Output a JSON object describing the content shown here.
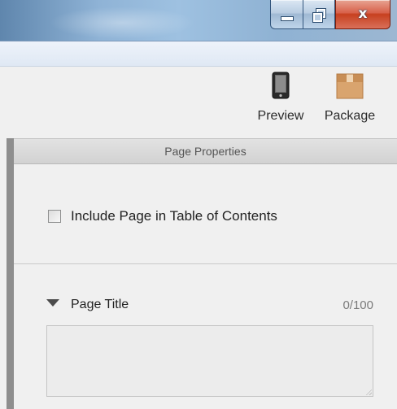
{
  "window": {
    "caption_buttons": [
      {
        "name": "minimize",
        "icon": "minimize-icon"
      },
      {
        "name": "maximize",
        "icon": "restore-icon"
      },
      {
        "name": "close",
        "icon": "close-icon",
        "glyph": "x"
      }
    ],
    "colors": {
      "titlebar": "#8fb3d6",
      "close_button": "#c7401f"
    }
  },
  "toolbar": {
    "preview_label": "Preview",
    "preview_icon": "tablet-icon",
    "package_label": "Package",
    "package_icon": "package-box-icon"
  },
  "panel": {
    "header_title": "Page Properties",
    "toc_checkbox": {
      "label": "Include Page in Table of Contents",
      "checked": false
    },
    "page_title": {
      "label": "Page Title",
      "counter": "0/100",
      "value": "",
      "expanded": true
    }
  }
}
